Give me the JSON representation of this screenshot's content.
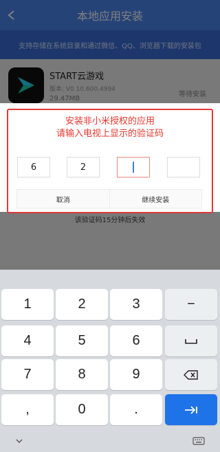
{
  "appbar": {
    "title": "本地应用安装"
  },
  "banner": {
    "text": "支持存储在系统目录和通过微信、QQ、浏览器下载的安装包"
  },
  "app": {
    "name": "START云游戏",
    "version": "版本: V0.10.600.4994",
    "size": "29.47MB",
    "status": "等待安装"
  },
  "dialog": {
    "title_line1": "安装非小米授权的应用",
    "title_line2": "请输入电视上显示的验证码",
    "codes": [
      "6",
      "2",
      "",
      ""
    ],
    "cancel_label": "取消",
    "continue_label": "继续安装",
    "expire_text": "该验证码15分钟后失效"
  },
  "keyboard": {
    "keys": {
      "k1": "1",
      "k2": "2",
      "k3": "3",
      "minus": "−",
      "k4": "4",
      "k5": "5",
      "k6": "6",
      "space": "␣",
      "k7": "7",
      "k8": "8",
      "k9": "9",
      "backspace": "⌫",
      "comma": ",",
      "k0": "0",
      "dot": ".",
      "enter": "⇥"
    }
  },
  "colors": {
    "accent": "#4c86f0",
    "dialog_red": "#e5372f",
    "enter_blue": "#1f73e8"
  }
}
